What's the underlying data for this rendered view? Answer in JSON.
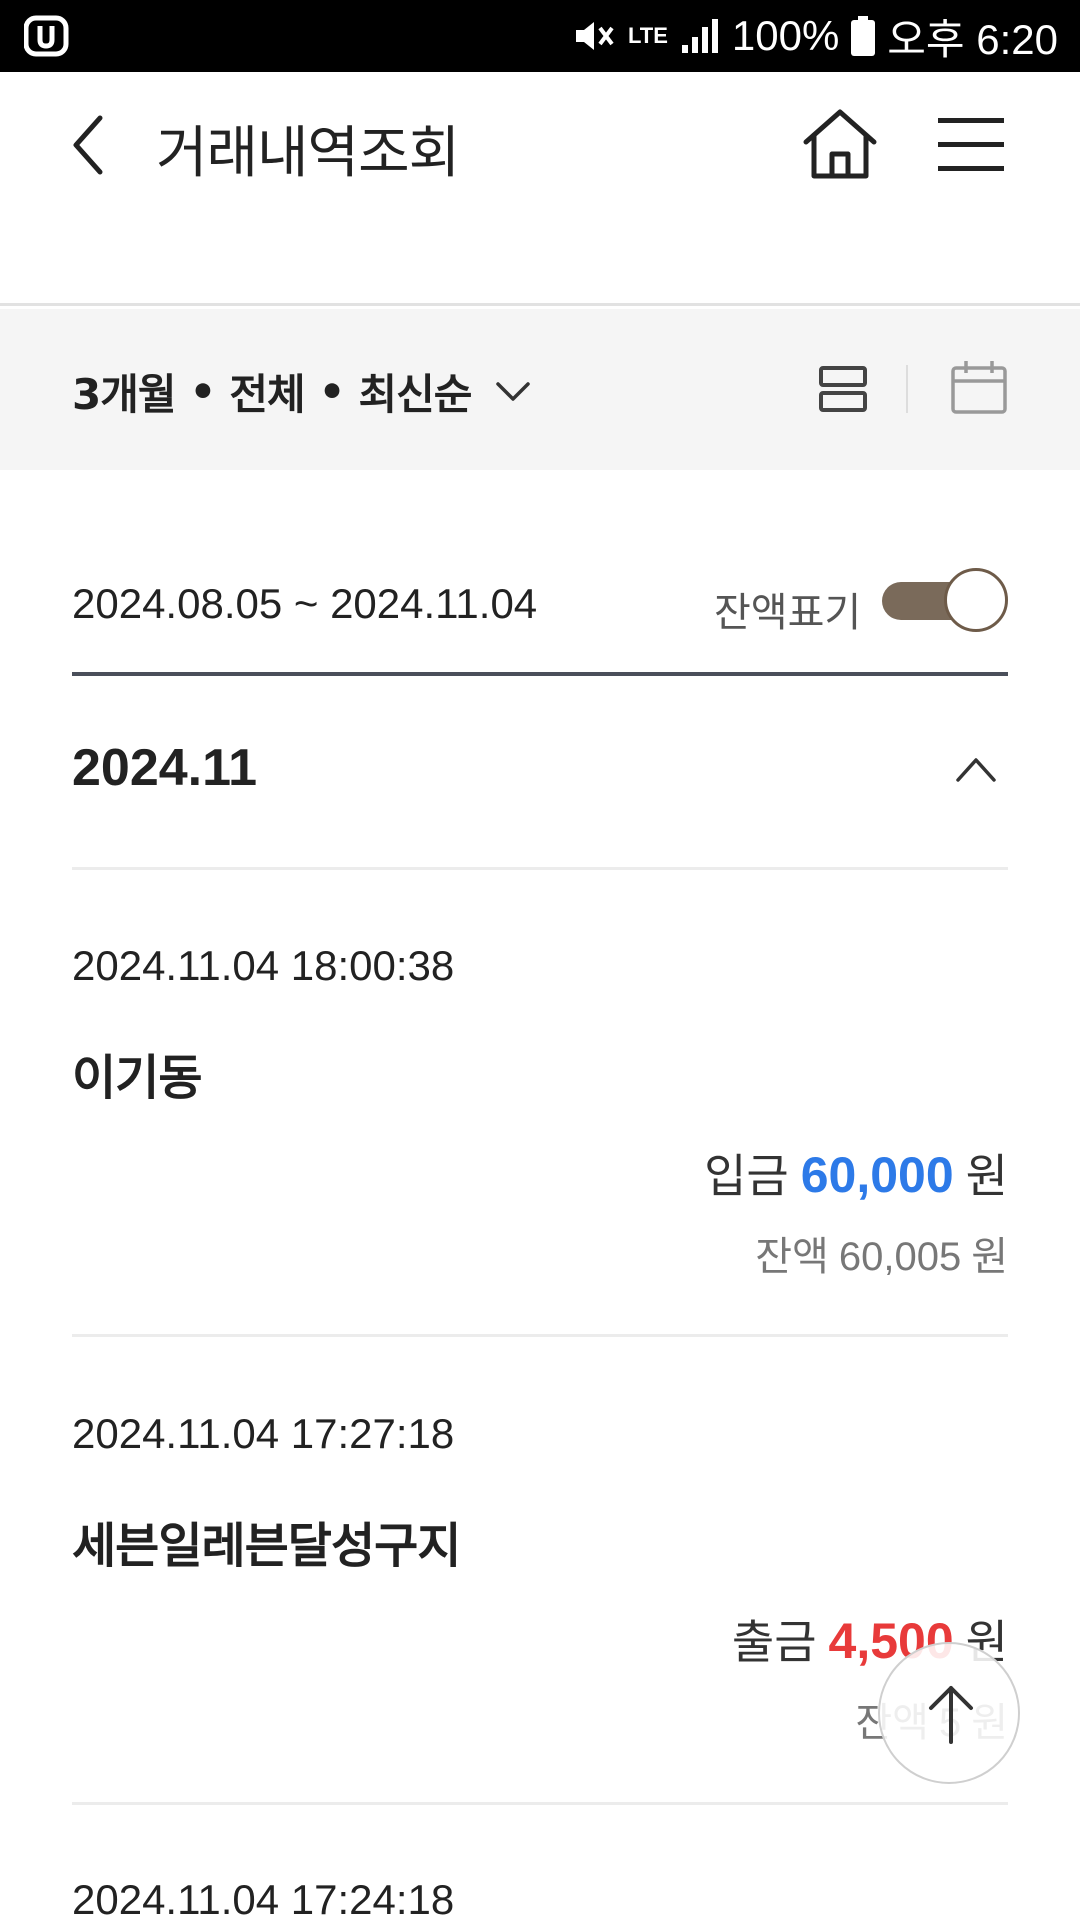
{
  "status_bar": {
    "battery": "100%",
    "time": "오후 6:20",
    "network": "LTE"
  },
  "header": {
    "title": "거래내역조회"
  },
  "filter": {
    "period": "3개월",
    "type": "전체",
    "order": "최신순",
    "dot": "•"
  },
  "range": {
    "text": "2024.08.05 ~ 2024.11.04",
    "balance_toggle_label": "잔액표기",
    "balance_toggle_on": true
  },
  "month_group": {
    "label": "2024.11"
  },
  "transactions": [
    {
      "datetime": "2024.11.04 18:00:38",
      "name": "이기동",
      "kind": "입금",
      "amount": "60,000",
      "unit": "원",
      "balance_label": "잔액",
      "balance": "60,005"
    },
    {
      "datetime": "2024.11.04 17:27:18",
      "name": "세븐일레븐달성구지",
      "kind": "출금",
      "amount": "4,500",
      "unit": "원",
      "balance_label": "잔액",
      "balance": "5"
    },
    {
      "datetime": "2024.11.04 17:24:18"
    }
  ],
  "colors": {
    "deposit": "#2d7ae8",
    "withdraw": "#e83a3a",
    "toggle": "#7a6a5a"
  }
}
